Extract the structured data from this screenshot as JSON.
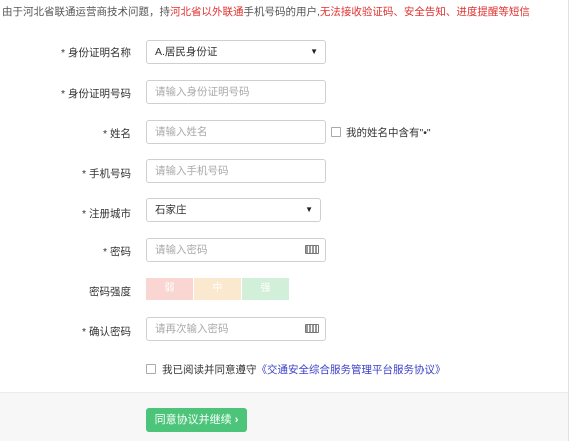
{
  "notice": {
    "part1": "由于河北省联通运营商技术问题，持",
    "part2": "河北省以外联通",
    "part3": "手机号码的用户,",
    "part4": "无法接收验证码、安全告知、进度提醒等短信"
  },
  "form": {
    "id_type": {
      "label": "身份证明名称",
      "value": "A.居民身份证"
    },
    "id_number": {
      "label": "身份证明号码",
      "placeholder": "请输入身份证明号码"
    },
    "name": {
      "label": "姓名",
      "placeholder": "请输入姓名",
      "checkbox_label": "我的姓名中含有\"•\""
    },
    "phone": {
      "label": "手机号码",
      "placeholder": "请输入手机号码"
    },
    "city": {
      "label": "注册城市",
      "value": "石家庄"
    },
    "password": {
      "label": "密码",
      "placeholder": "请输入密码"
    },
    "strength": {
      "label": "密码强度",
      "levels": [
        "弱",
        "中",
        "强"
      ],
      "colors": [
        "#f9d6d2",
        "#fbe9cf",
        "#d2f0d9"
      ]
    },
    "confirm_password": {
      "label": "确认密码",
      "placeholder": "请再次输入密码"
    },
    "required_mark": "*"
  },
  "agreement": {
    "text": "我已阅读并同意遵守",
    "link": "《交通安全综合服务管理平台服务协议》"
  },
  "submit": {
    "label": "同意协议并继续",
    "icon": "chevron-right-icon",
    "color": "#4cc57a"
  }
}
